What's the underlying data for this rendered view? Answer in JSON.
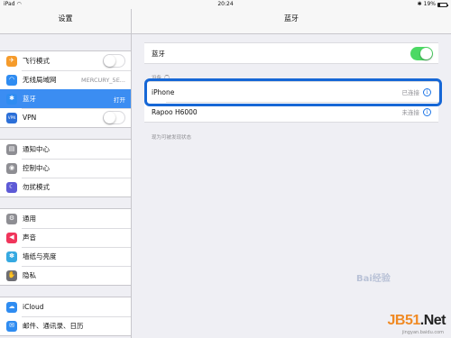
{
  "status_bar": {
    "device": "iPad",
    "time": "20:24",
    "bluetooth_glyph": "✱",
    "battery_text": "19%",
    "battery_level": 0.19
  },
  "left_pane": {
    "title": "设置",
    "groups": [
      {
        "items": [
          {
            "label": "飞行模式",
            "icon": "airplane-icon",
            "icon_glyph": "✈",
            "icon_color": "#f59b2b",
            "toggle": "off"
          },
          {
            "label": "无线局域网",
            "icon": "wifi-icon",
            "icon_glyph": "◠",
            "icon_color": "#2f8cf1",
            "value": "MERCURY_5E..."
          },
          {
            "label": "蓝牙",
            "icon": "bluetooth-icon",
            "icon_glyph": "✱",
            "icon_color": "#2f8cf1",
            "value": "打开",
            "selected": true
          },
          {
            "label": "VPN",
            "icon": "vpn-icon",
            "icon_glyph": "VPN",
            "icon_color": "#2b6fd8",
            "toggle": "off"
          }
        ]
      },
      {
        "items": [
          {
            "label": "通知中心",
            "icon": "notification-center-icon",
            "icon_glyph": "▤",
            "icon_color": "#8e8e93"
          },
          {
            "label": "控制中心",
            "icon": "control-center-icon",
            "icon_glyph": "◉",
            "icon_color": "#8e8e93"
          },
          {
            "label": "勿扰模式",
            "icon": "do-not-disturb-icon",
            "icon_glyph": "☾",
            "icon_color": "#5d5ad6"
          }
        ]
      },
      {
        "items": [
          {
            "label": "通用",
            "icon": "general-gear-icon",
            "icon_glyph": "⚙",
            "icon_color": "#8e8e93"
          },
          {
            "label": "声音",
            "icon": "sound-icon",
            "icon_glyph": "◀",
            "icon_color": "#f0355b"
          },
          {
            "label": "墙纸与亮度",
            "icon": "wallpaper-icon",
            "icon_glyph": "✽",
            "icon_color": "#36a9e1"
          },
          {
            "label": "隐私",
            "icon": "privacy-hand-icon",
            "icon_glyph": "✋",
            "icon_color": "#6e6e73"
          }
        ]
      },
      {
        "items": [
          {
            "label": "iCloud",
            "icon": "icloud-icon",
            "icon_glyph": "☁",
            "icon_color": "#2f8cf1"
          },
          {
            "label": "邮件、通讯录、日历",
            "icon": "mail-icon",
            "icon_glyph": "✉",
            "icon_color": "#2f8cf1"
          }
        ]
      }
    ]
  },
  "right_pane": {
    "title": "蓝牙",
    "bluetooth_label": "蓝牙",
    "bluetooth_toggle": "on",
    "devices_section_label": "设备",
    "devices": [
      {
        "name": "iPhone",
        "status": "已连接"
      },
      {
        "name": "Rapoo H6000",
        "status": "未连接"
      }
    ],
    "footer_note": "现为可被发现状态"
  },
  "watermark": {
    "brand_prefix": "JB51",
    "brand_suffix": ".Net",
    "sub": "jingyan.baidu.com",
    "baidu": "Bai经验"
  },
  "colors": {
    "selection": "#3b8df2",
    "toggle_on": "#4cd964",
    "highlight_border": "#1667d6"
  }
}
